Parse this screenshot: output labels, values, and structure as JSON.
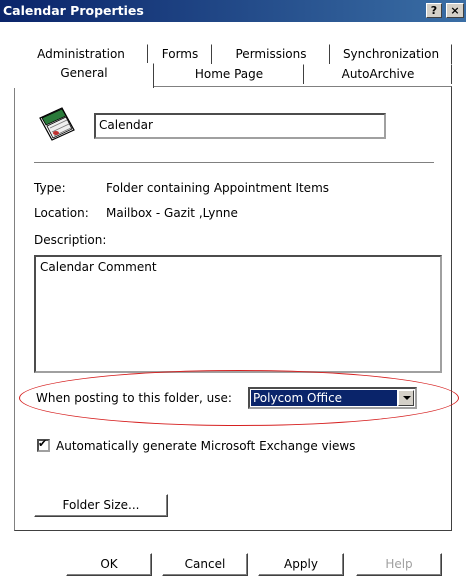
{
  "window": {
    "title": "Calendar Properties",
    "help_button": "?",
    "close_button": "×"
  },
  "tabs": {
    "row1": [
      "Administration",
      "Forms",
      "Permissions",
      "Synchronization"
    ],
    "row2": [
      "General",
      "Home Page",
      "AutoArchive"
    ],
    "active": "General"
  },
  "general": {
    "folder_name": "Calendar",
    "type_label": "Type:",
    "type_value": "Folder containing Appointment Items",
    "location_label": "Location:",
    "location_value": "Mailbox - Gazit ,Lynne",
    "description_label": "Description:",
    "description_value": "Calendar Comment",
    "posting_label": "When posting to this folder, use:",
    "posting_value": "Polycom Office",
    "auto_views_label": "Automatically generate Microsoft Exchange views",
    "auto_views_checked": true,
    "folder_size_label": "Folder Size..."
  },
  "footer": {
    "ok": "OK",
    "cancel": "Cancel",
    "apply": "Apply",
    "help": "Help"
  },
  "colors": {
    "titlebar": "#0a246a",
    "selection": "#0a246a",
    "highlight_ellipse": "#d62020"
  }
}
